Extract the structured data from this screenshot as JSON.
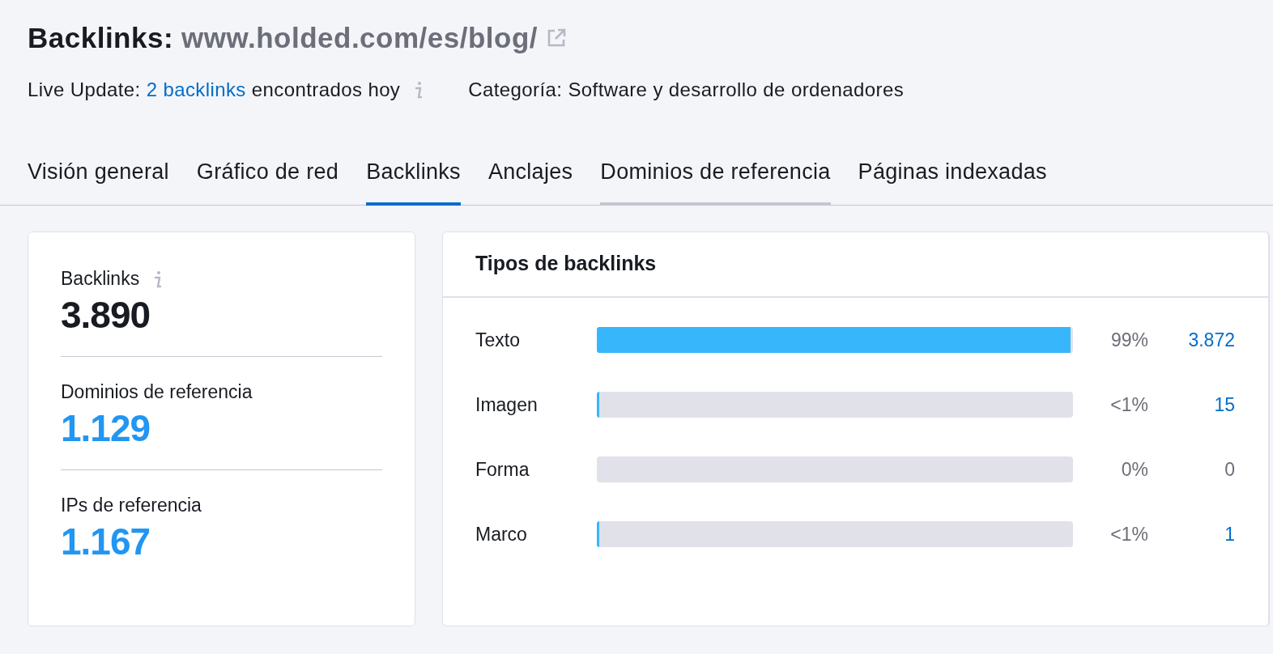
{
  "header": {
    "title": "Backlinks:",
    "url": "www.holded.com/es/blog/",
    "live_update": {
      "prefix": "Live Update:",
      "link": "2 backlinks",
      "suffix": "encontrados hoy"
    },
    "category": "Categoría: Software y desarrollo de ordenadores"
  },
  "tabs": [
    {
      "label": "Visión general",
      "selected": false,
      "hovered": false
    },
    {
      "label": "Gráfico de red",
      "selected": false,
      "hovered": false
    },
    {
      "label": "Backlinks",
      "selected": true,
      "hovered": false
    },
    {
      "label": "Anclajes",
      "selected": false,
      "hovered": false
    },
    {
      "label": "Dominios de referencia",
      "selected": false,
      "hovered": true
    },
    {
      "label": "Páginas indexadas",
      "selected": false,
      "hovered": false
    }
  ],
  "summary": [
    {
      "label": "Backlinks",
      "value": "3.890",
      "info": true,
      "highlight": false
    },
    {
      "label": "Dominios de referencia",
      "value": "1.129",
      "info": false,
      "highlight": true
    },
    {
      "label": "IPs de referencia",
      "value": "1.167",
      "info": false,
      "highlight": true
    }
  ],
  "types": {
    "title": "Tipos de backlinks",
    "rows": [
      {
        "label": "Texto",
        "level": 0.995,
        "percent": "99%",
        "count": "3.872",
        "linked": true
      },
      {
        "label": "Imagen",
        "level": 0.004,
        "percent": "<1%",
        "count": "15",
        "linked": true
      },
      {
        "label": "Forma",
        "level": 0,
        "percent": "0%",
        "count": "0",
        "linked": false
      },
      {
        "label": "Marco",
        "level": 0.004,
        "percent": "<1%",
        "count": "1",
        "linked": true
      }
    ]
  }
}
